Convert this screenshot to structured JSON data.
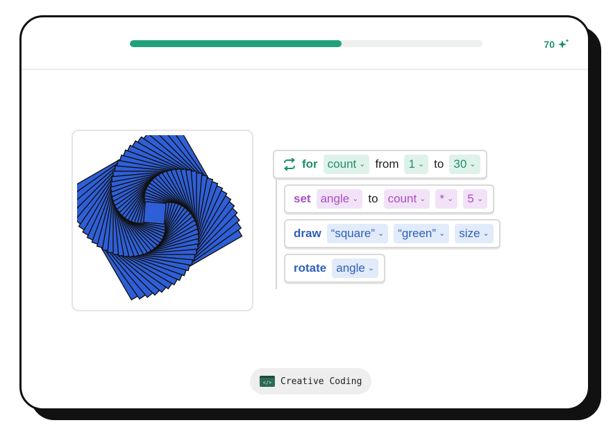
{
  "progress": {
    "value": 0.6
  },
  "score": {
    "value": "70",
    "icon": "sparkle-icon"
  },
  "blocks": {
    "for": {
      "icon": "loop-arrows-icon",
      "keyword": "for",
      "variable": "count",
      "from_label": "from",
      "from_value": "1",
      "to_label": "to",
      "to_value": "30"
    },
    "set": {
      "keyword": "set",
      "variable": "angle",
      "to_label": "to",
      "operand": "count",
      "operator": "*",
      "value": "5"
    },
    "draw": {
      "keyword": "draw",
      "shape": "“square”",
      "color": "“green”",
      "size": "size"
    },
    "rotate": {
      "keyword": "rotate",
      "value": "angle"
    }
  },
  "category_chip": {
    "icon": "code-window-icon",
    "label": "Creative Coding"
  },
  "colors": {
    "accent": "#22a07b",
    "square_fill": "#2f5fd8",
    "square_stroke": "#111111"
  }
}
